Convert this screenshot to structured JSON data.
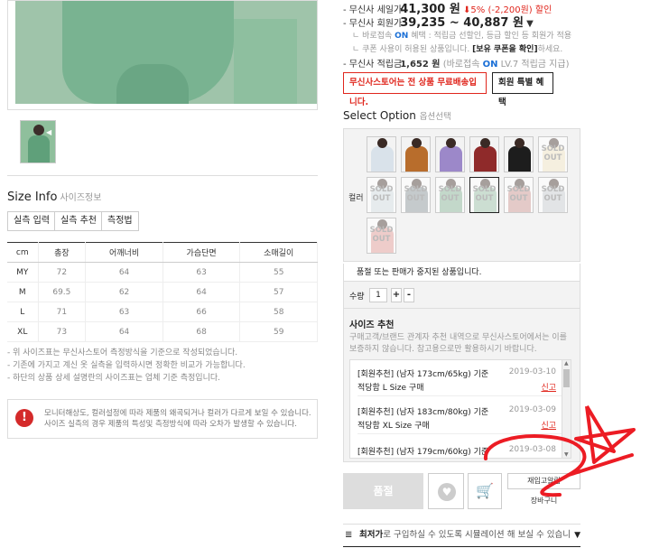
{
  "price": {
    "sale_label": "- 무신사 세일가",
    "sale_price": "41,300 원",
    "discount": "5% (-2,200원) 할인",
    "member_label": "- 무신사 회원가",
    "member_price": "39,235 ~ 40,887 원",
    "member_chevron": "▼",
    "note1_prefix": "ㄴ 바로접속",
    "note1_on": "ON",
    "note1_suffix": "혜택 : 적립금 선할인, 등급 할인 등 회원가 적용",
    "note2_prefix": "ㄴ 쿠폰 사용이 허용된 상품입니다.",
    "note2_link": "[보유 쿠폰을 확인]",
    "note2_suffix": "하세요.",
    "points_label": "- 무신사 적립금",
    "points_value": "1,652 원",
    "points_note_prefix": "(바로접속",
    "points_note_on": "ON",
    "points_note_suffix": "LV.7 적립금 지급)",
    "free_shipping": "무신사스토어는 전 상품 무료배송입니다.",
    "member_benefit": "회원 특별 혜택"
  },
  "option": {
    "title": "Select Option",
    "title_sub": "옵션선택",
    "color_label": "컬러",
    "soldout_text": "SOLD OUT",
    "swatches": [
      {
        "color": "#d9e2ea",
        "soldout": false
      },
      {
        "color": "#b86d2c",
        "soldout": false
      },
      {
        "color": "#9c88c9",
        "soldout": false
      },
      {
        "color": "#8f2a2a",
        "soldout": false
      },
      {
        "color": "#1d1d1d",
        "soldout": false
      },
      {
        "color": "#e9dcb8",
        "soldout": true
      },
      {
        "color": "#c7d3d8",
        "soldout": true
      },
      {
        "color": "#7e8a8e",
        "soldout": true
      },
      {
        "color": "#7aa88a",
        "soldout": true
      },
      {
        "color": "#8fb59c",
        "soldout": true,
        "selected": true
      },
      {
        "color": "#c48a86",
        "soldout": true
      },
      {
        "color": "#bfc3c8",
        "soldout": true
      },
      {
        "color": "#d98f8b",
        "soldout": true
      }
    ],
    "soldout_notice": "품절 또는 판매가 중지된 상품입니다.",
    "qty_label": "수량",
    "qty_value": "1",
    "plus": "+",
    "minus": "-"
  },
  "recommend": {
    "title": "사이즈 추천",
    "desc": "구매고객/브랜드 관계자 추천 내역으로 무신사스토어에서는 이를 보증하지 않습니다. 참고용으로만 활용하시기 바랍니다.",
    "items": [
      {
        "title": "[회원추천] (남자 173cm/65kg) 기준",
        "date": "2019-03-10",
        "size": "적당함 L Size 구매",
        "report": "신고"
      },
      {
        "title": "[회원추천] (남자 183cm/80kg) 기준",
        "date": "2019-03-09",
        "size": "적당함 XL Size 구매",
        "report": "신고"
      },
      {
        "title": "[회원추천] (남자 179cm/60kg) 기준",
        "date": "2019-03-08",
        "size": "",
        "report": ""
      }
    ]
  },
  "actions": {
    "buy": "품절",
    "restock": "재입고알림",
    "wishlist": "장바구니",
    "sim_prefix": "최저가",
    "sim_text": "로 구입하실 수 있도록 시뮬레이션 해 보실 수 있습니다.",
    "sim_arrow": "▼"
  },
  "size_info": {
    "title": "Size Info",
    "title_sub": "사이즈정보",
    "btn_measure": "실측 입력",
    "btn_recommend": "실측 추천",
    "btn_method": "측정법",
    "headers": [
      "cm",
      "총장",
      "어깨너비",
      "가슴단면",
      "소매길이"
    ],
    "rows": [
      [
        "MY",
        "72",
        "64",
        "63",
        "55"
      ],
      [
        "M",
        "69.5",
        "62",
        "64",
        "57"
      ],
      [
        "L",
        "71",
        "63",
        "66",
        "58"
      ],
      [
        "XL",
        "73",
        "64",
        "68",
        "59"
      ]
    ],
    "notes": [
      "- 위 사이즈표는 무신사스토어 측정방식을 기준으로 작성되었습니다.",
      "- 기존에 가지고 계신 옷 실측을 입력하시면 정확한 비교가 가능합니다.",
      "- 하단의 상품 상세 설명란의 사이즈표는 업체 기준 측정입니다."
    ],
    "warn_icon": "!",
    "warn_line1": "모니터해상도, 컬러설정에 따라 제품의 왜곡되거나 컬러가 다르게 보일 수 있습니다.",
    "warn_line2": "사이즈 실측의 경우 제품의 특성및 측정방식에 따라 오차가 발생할 수 있습니다."
  }
}
